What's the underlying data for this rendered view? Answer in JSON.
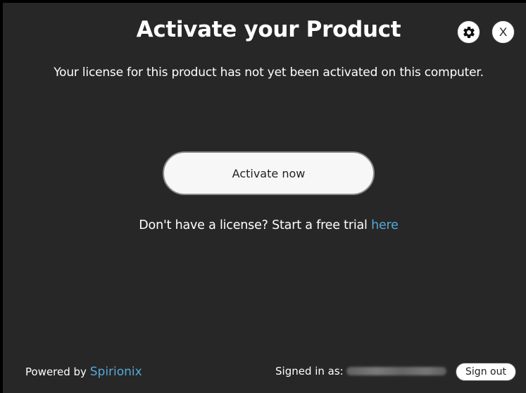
{
  "dialog": {
    "title": "Activate your Product",
    "message": "Your license for this product has not yet been activated on this computer.",
    "activate_label": "Activate now",
    "trial_text": "Don't have a license? Start a free trial",
    "trial_link": "here",
    "close_label": "X"
  },
  "footer": {
    "powered_by": "Powered by",
    "brand": "Spirionix",
    "signed_in_label": "Signed in as:",
    "sign_out_label": "Sign out"
  },
  "icons": {
    "settings": "gear-icon"
  },
  "colors": {
    "background": "#272727",
    "accent": "#55a9d6",
    "button": "#f7f7f7"
  }
}
